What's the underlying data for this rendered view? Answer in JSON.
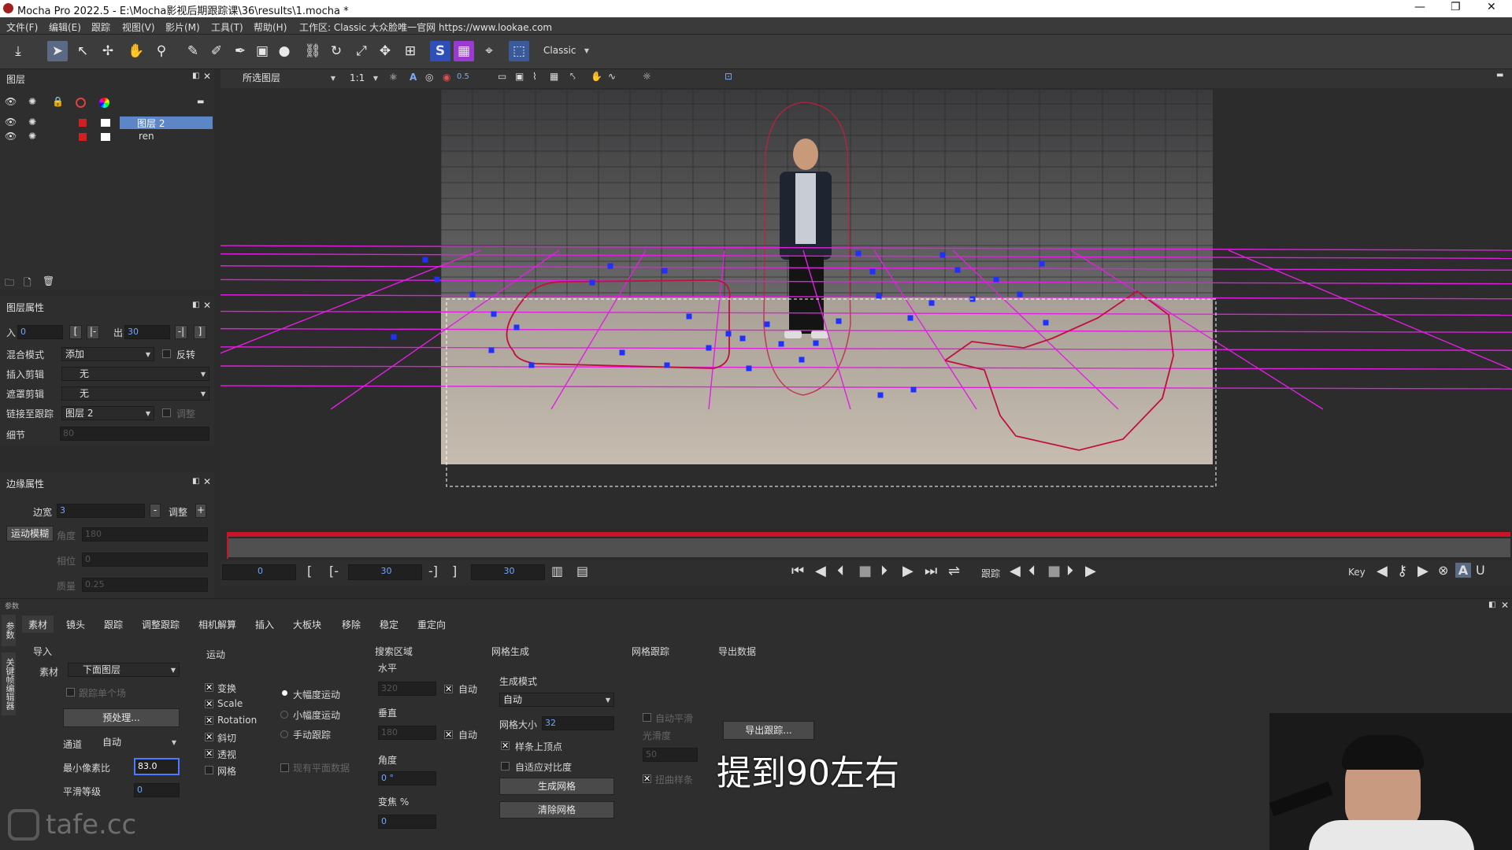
{
  "window": {
    "title": "Mocha Pro 2022.5 - E:\\Mocha影视后期跟踪课\\36\\results\\1.mocha *"
  },
  "menu": [
    "文件(F)",
    "编辑(E)",
    "跟踪",
    "视图(V)",
    "影片(M)",
    "工具(T)",
    "帮助(H)",
    "工作区: Classic 大众脸唯一官网 https://www.lookae.com"
  ],
  "toolbar": {
    "workspace": "Classic"
  },
  "layers_panel": {
    "title": "图层",
    "layers": [
      {
        "name": "图层 2",
        "selected": true
      },
      {
        "name": "ren",
        "selected": false
      }
    ]
  },
  "viewer": {
    "clip_select": "所选图层",
    "zoom": "1:1",
    "opacity": "0.5"
  },
  "layer_props": {
    "title": "图层属性",
    "in_label": "入",
    "in_value": "0",
    "out_label": "出",
    "out_value": "30",
    "blend_label": "混合模式",
    "blend_value": "添加",
    "invert_label": "反转",
    "insert_clip_label": "插入剪辑",
    "insert_clip_value": "无",
    "matte_clip_label": "遮罩剪辑",
    "matte_clip_value": "无",
    "link_track_label": "链接至跟踪",
    "link_track_value": "图层 2",
    "link_adjust_label": "调整",
    "detail_label": "细节",
    "detail_value": "80"
  },
  "edge_props": {
    "title": "边缘属性",
    "width_label": "边宽",
    "width_value": "3",
    "adjust_label": "调整",
    "motion_blur_label": "运动模糊",
    "angle_label": "角度",
    "angle_value": "180",
    "phase_label": "相位",
    "phase_value": "0",
    "quality_label": "质量",
    "quality_value": "0.25"
  },
  "timeline": {
    "current_frame": "0",
    "in_frame": "30",
    "out_frame": "30",
    "track_label": "跟踪",
    "key_label": "Key"
  },
  "params": {
    "side_label": "参数",
    "side_label2": "关键帧编辑器",
    "tabs": [
      "素材",
      "镜头",
      "跟踪",
      "调整跟踪",
      "相机解算",
      "插入",
      "大板块",
      "移除",
      "稳定",
      "重定向"
    ],
    "import_label": "导入",
    "clip_label": "素材",
    "clip_value": "下面图层",
    "track_single_label": "跟踪单个场",
    "preprocess_button": "预处理...",
    "channel_label": "通道",
    "channel_value": "自动",
    "min_pixel_label": "最小像素比",
    "min_pixel_value": "83.0",
    "smooth_label": "平滑等级",
    "smooth_value": "0",
    "motion_title": "运动",
    "motion_opts": [
      "变换",
      "Scale",
      "Rotation",
      "斜切",
      "透视",
      "网格"
    ],
    "motion_checked": [
      true,
      true,
      true,
      true,
      true,
      false
    ],
    "range_opts": [
      "大幅度运动",
      "小幅度运动",
      "手动跟踪"
    ],
    "existing_plane_label": "现有平面数据",
    "search_title": "搜索区域",
    "horizontal_label": "水平",
    "horizontal_value": "320",
    "auto_label": "自动",
    "vertical_label": "垂直",
    "vertical_value": "180",
    "angle_label": "角度",
    "angle_value": "0 °",
    "zoom_label": "变焦 %",
    "zoom_value": "0",
    "mesh_title": "网格生成",
    "gen_mode_label": "生成模式",
    "gen_mode_value": "自动",
    "mesh_size_label": "网格大小",
    "mesh_size_value": "32",
    "spline_vertices_label": "样条上顶点",
    "adaptive_contrast_label": "自适应对比度",
    "generate_mesh_button": "生成网格",
    "clear_mesh_button": "清除网格",
    "mesh_track_title": "网格跟踪",
    "auto_smooth_label": "自动平滑",
    "smoothness_label": "光滑度",
    "smoothness_value": "50",
    "warp_spline_label": "扭曲样条",
    "export_title": "导出数据",
    "export_button": "导出跟踪..."
  },
  "overlay": {
    "subtitle": "提到90左右",
    "watermark": "tafe.cc"
  },
  "colors": {
    "accent": "#5a6a85",
    "mesh": "#e020e0",
    "spline": "#c01040",
    "points": "#2030ff",
    "timeline_red": "#c81428"
  }
}
